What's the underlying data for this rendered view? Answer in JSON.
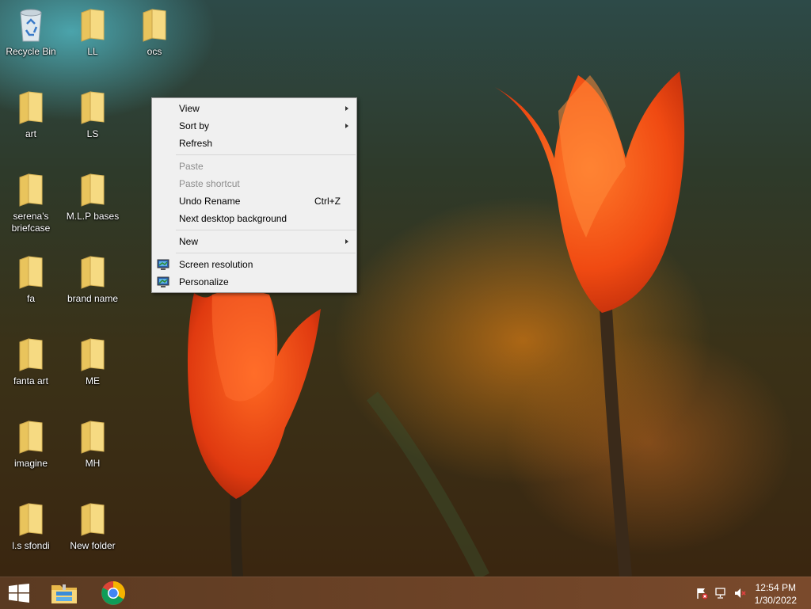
{
  "desktop": {
    "icons": [
      {
        "label": "Recycle Bin",
        "type": "recycle-bin"
      },
      {
        "label": "LL",
        "type": "folder"
      },
      {
        "label": "ocs",
        "type": "folder"
      },
      {
        "label": "art",
        "type": "folder"
      },
      {
        "label": "LS",
        "type": "folder"
      },
      {
        "label": "serena's briefcase",
        "type": "folder"
      },
      {
        "label": "M.L.P bases",
        "type": "folder"
      },
      {
        "label": "fa",
        "type": "folder"
      },
      {
        "label": "brand name",
        "type": "folder"
      },
      {
        "label": "fanta art",
        "type": "folder"
      },
      {
        "label": "ME",
        "type": "folder"
      },
      {
        "label": "imagine",
        "type": "folder"
      },
      {
        "label": "MH",
        "type": "folder"
      },
      {
        "label": "l.s sfondi",
        "type": "folder"
      },
      {
        "label": "New folder",
        "type": "folder"
      }
    ]
  },
  "context_menu": {
    "items": [
      {
        "label": "View",
        "submenu": true
      },
      {
        "label": "Sort by",
        "submenu": true
      },
      {
        "label": "Refresh"
      },
      {
        "label": "Paste",
        "disabled": true
      },
      {
        "label": "Paste shortcut",
        "disabled": true
      },
      {
        "label": "Undo Rename",
        "shortcut": "Ctrl+Z"
      },
      {
        "label": "Next desktop background"
      },
      {
        "label": "New",
        "submenu": true
      },
      {
        "label": "Screen resolution",
        "icon": "monitor-icon"
      },
      {
        "label": "Personalize",
        "icon": "monitor-icon"
      }
    ]
  },
  "taskbar": {
    "pinned": [
      {
        "name": "file-explorer-icon"
      },
      {
        "name": "chrome-icon"
      }
    ],
    "tray": {
      "icons": [
        "action-center-flag-icon",
        "network-icon",
        "volume-muted-icon"
      ],
      "time": "12:54 PM",
      "date": "1/30/2022"
    }
  },
  "colors": {
    "menu_bg": "#f0f0f0",
    "menu_disabled_text": "#8d8d8d",
    "taskbar_bg": "#6b4226",
    "folder_yellow": "#f5d677"
  }
}
